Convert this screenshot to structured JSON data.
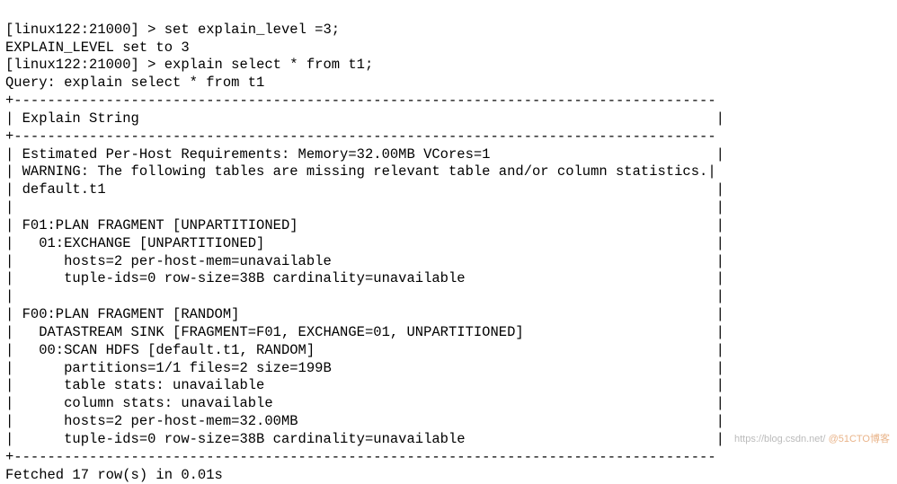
{
  "lines": {
    "0": {
      "prompt": "[linux122:21000] >",
      "cmd": "set explain_level =3;"
    },
    "1": "EXPLAIN_LEVEL set to 3",
    "2": {
      "prompt": "[linux122:21000] >",
      "cmd": "explain select * from t1;"
    },
    "3": "Query: explain select * from t1",
    "4": "+------------------------------------------------------------------------------------",
    "5": "| Explain String                                                                     |",
    "6": "+------------------------------------------------------------------------------------",
    "7": "| Estimated Per-Host Requirements: Memory=32.00MB VCores=1                           |",
    "8": "| WARNING: The following tables are missing relevant table and/or column statistics.|",
    "9": "| default.t1                                                                         |",
    "10": "|                                                                                    |",
    "11": "| F01:PLAN FRAGMENT [UNPARTITIONED]                                                  |",
    "12": "|   01:EXCHANGE [UNPARTITIONED]                                                      |",
    "13": "|      hosts=2 per-host-mem=unavailable                                              |",
    "14": "|      tuple-ids=0 row-size=38B cardinality=unavailable                              |",
    "15": "|                                                                                    |",
    "16": "| F00:PLAN FRAGMENT [RANDOM]                                                         |",
    "17": "|   DATASTREAM SINK [FRAGMENT=F01, EXCHANGE=01, UNPARTITIONED]                       |",
    "18": "|   00:SCAN HDFS [default.t1, RANDOM]                                                |",
    "19": "|      partitions=1/1 files=2 size=199B                                              |",
    "20": "|      table stats: unavailable                                                      |",
    "21": "|      column stats: unavailable                                                     |",
    "22": "|      hosts=2 per-host-mem=32.00MB                                                  |",
    "23": "|      tuple-ids=0 row-size=38B cardinality=unavailable                              |",
    "24": "+------------------------------------------------------------------------------------",
    "25": "Fetched 17 row(s) in 0.01s"
  },
  "watermark": {
    "faint": "https://blog.csdn.net/ ",
    "orange": "@51CTO博客"
  }
}
